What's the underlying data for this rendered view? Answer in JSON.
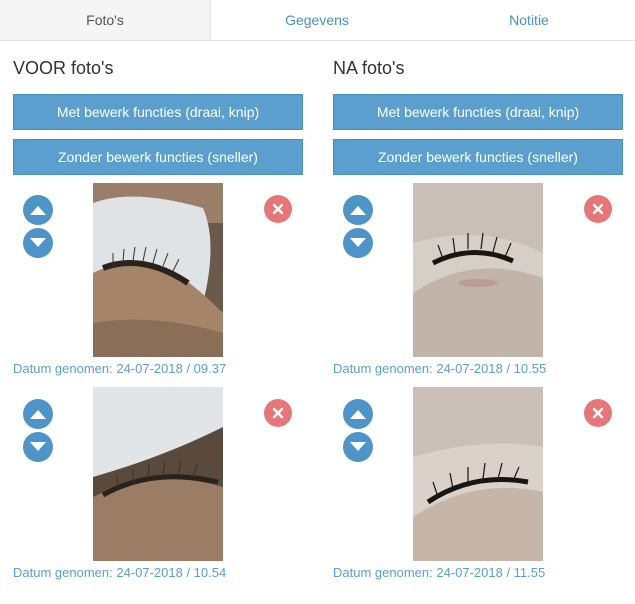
{
  "tabs": [
    {
      "label": "Foto's"
    },
    {
      "label": "Gegevens"
    },
    {
      "label": "Notitie"
    }
  ],
  "columns": [
    {
      "title": "VOOR foto's",
      "button_edit": "Met bewerk functies (draai, knip)",
      "button_noedit": "Zonder bewerk functies (sneller)",
      "photos": [
        {
          "date": "Datum genomen: 24-07-2018 / 09.37"
        },
        {
          "date": "Datum genomen: 24-07-2018 / 10.54"
        }
      ]
    },
    {
      "title": "NA foto's",
      "button_edit": "Met bewerk functies (draai, knip)",
      "button_noedit": "Zonder bewerk functies (sneller)",
      "photos": [
        {
          "date": "Datum genomen: 24-07-2018 / 10.55"
        },
        {
          "date": "Datum genomen: 24-07-2018 / 11.55"
        }
      ]
    }
  ],
  "icons": {
    "move_up": "arrow-up-icon",
    "move_down": "arrow-down-icon",
    "delete": "close-icon"
  },
  "colors": {
    "primary": "#5b9fcf",
    "circle": "#4f94c8",
    "delete": "#e5767a",
    "active_tab": "#f5f5f5"
  }
}
